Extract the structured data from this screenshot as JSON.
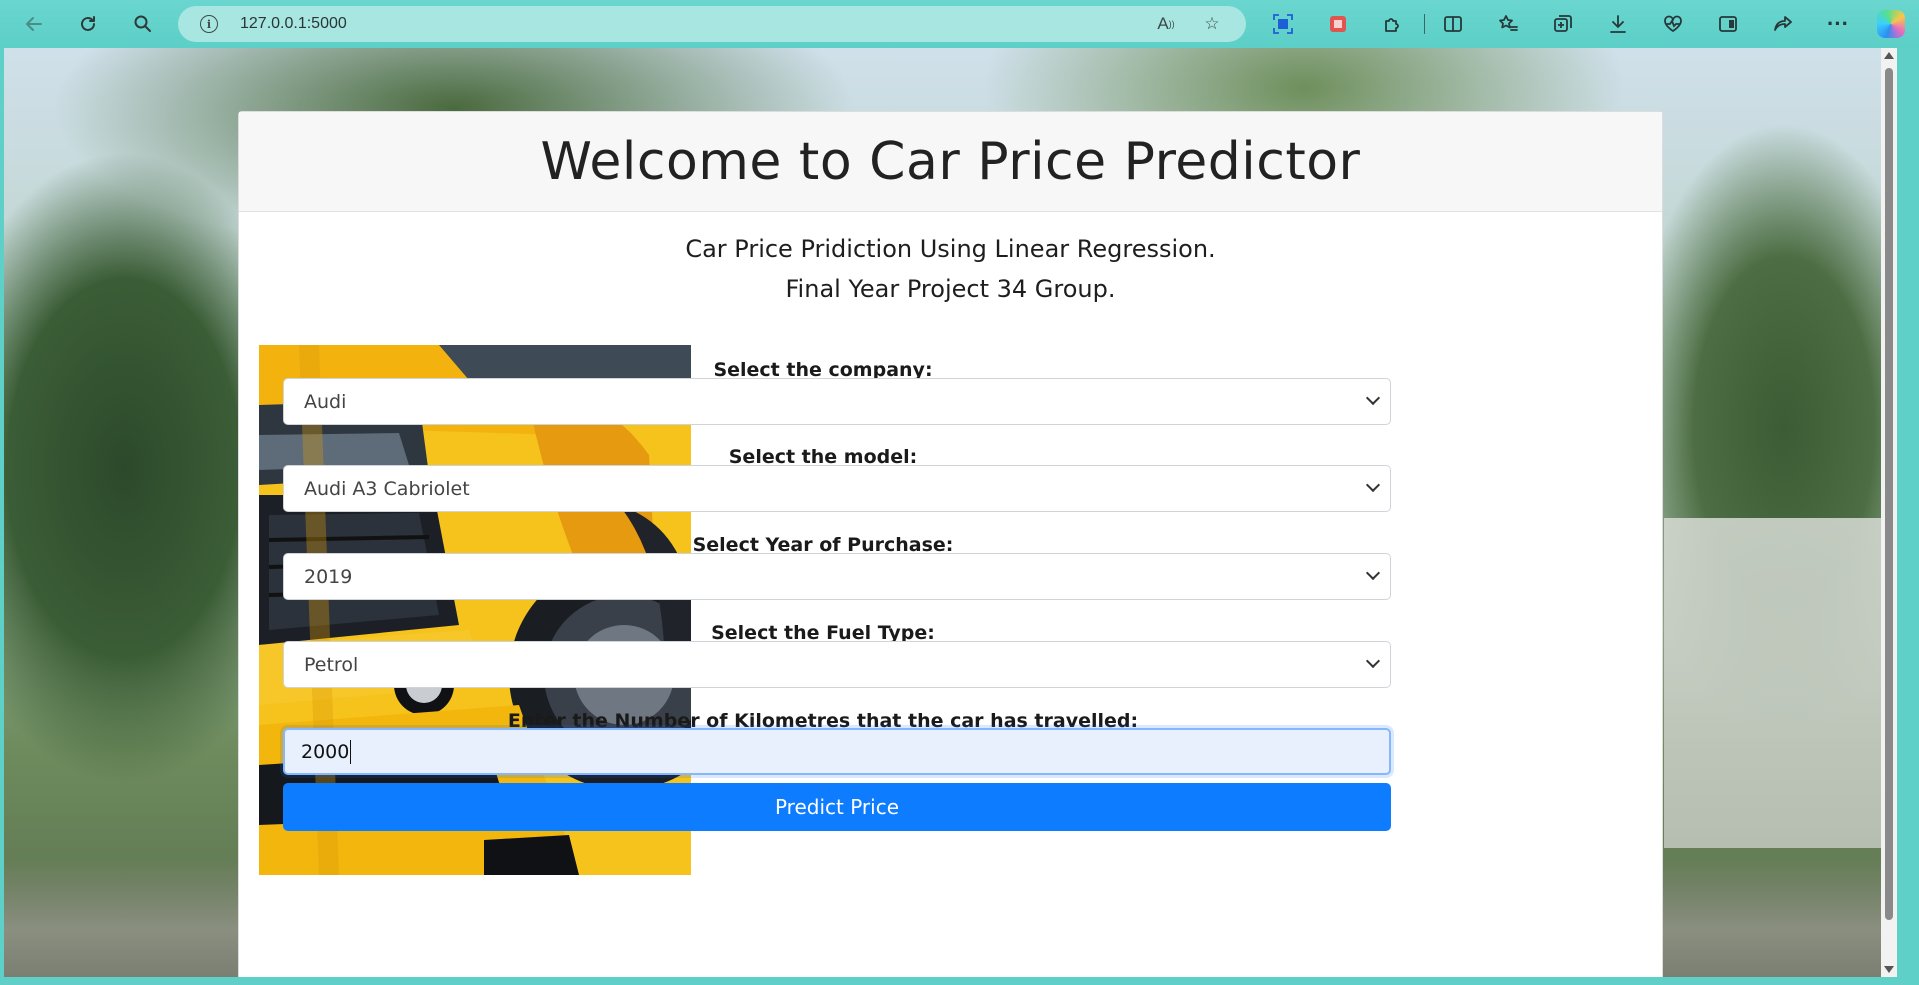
{
  "browser": {
    "url": "127.0.0.1:5000"
  },
  "page": {
    "title": "Welcome to Car Price Predictor",
    "subtitle_line1": "Car Price Pridiction Using Linear Regression.",
    "subtitle_line2": "Final Year Project 34 Group."
  },
  "form": {
    "company_label": "Select the company:",
    "company_value": "Audi",
    "model_label": "Select the model:",
    "model_value": "Audi A3 Cabriolet",
    "year_label": "Select Year of Purchase:",
    "year_value": "2019",
    "fuel_label": "Select the Fuel Type:",
    "fuel_value": "Petrol",
    "km_label": "Enter the Number of Kilometres that the car has travelled:",
    "km_value": "2000",
    "submit_label": "Predict Price"
  },
  "colors": {
    "browser_bar": "#5fd0c8",
    "button": "#0d7cff",
    "input_focus": "#e8f0fe"
  }
}
